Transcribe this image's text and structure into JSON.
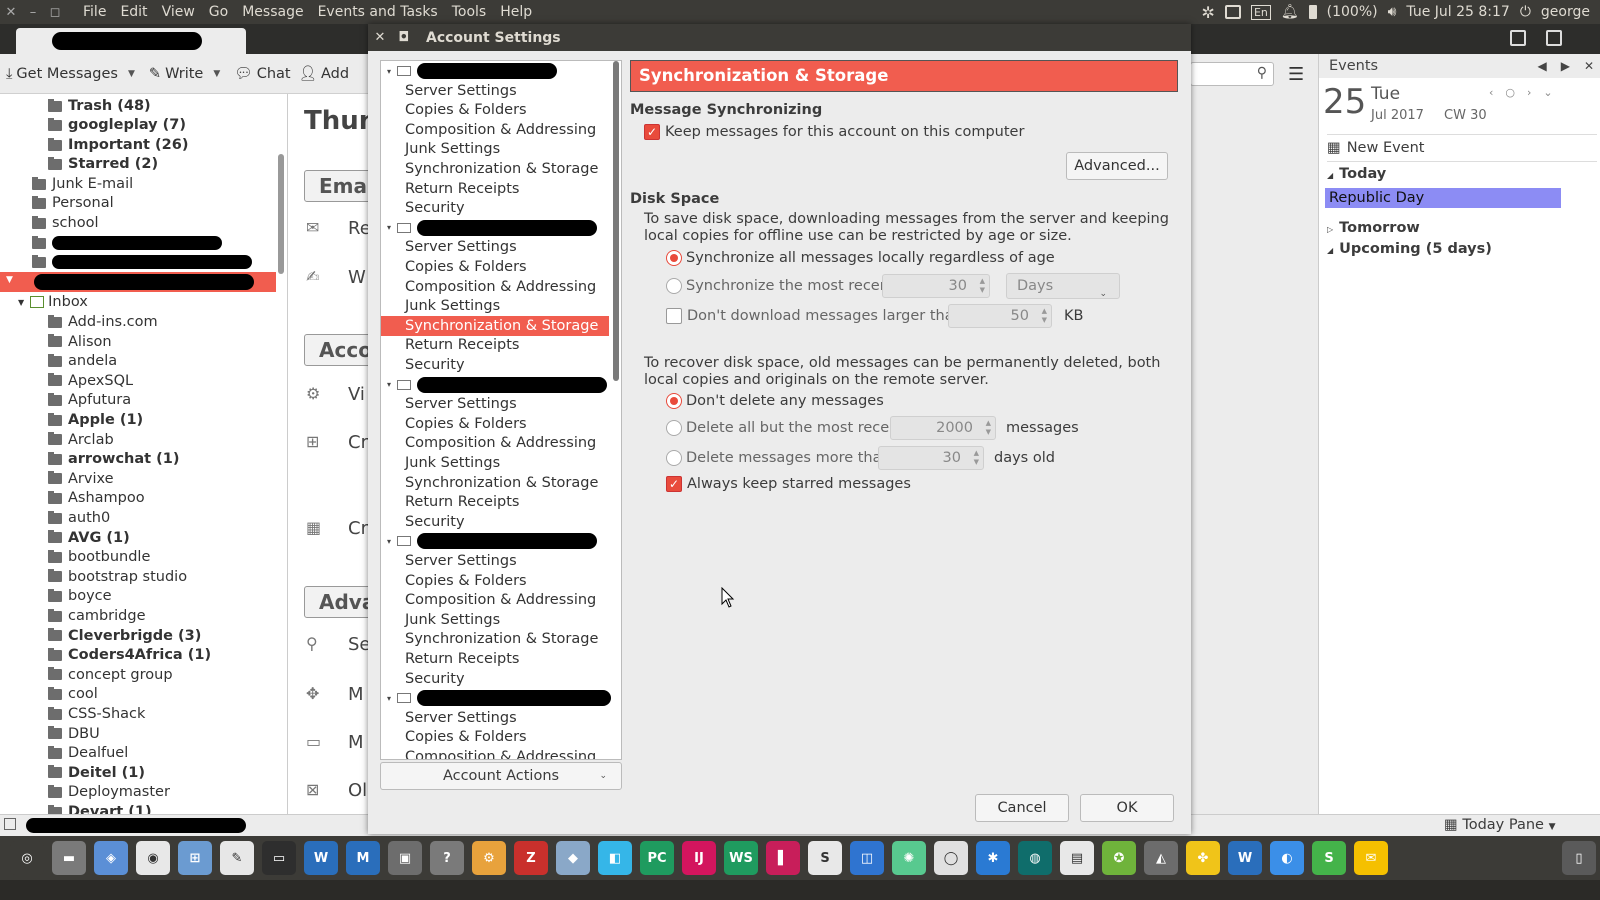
{
  "system_bar": {
    "menu": [
      "File",
      "Edit",
      "View",
      "Go",
      "Message",
      "Events and Tasks",
      "Tools",
      "Help"
    ],
    "battery": "(100%)",
    "datetime": "Tue Jul 25  8:17",
    "user": "george",
    "keyboard": "En"
  },
  "toolbar": {
    "get_messages": "Get Messages",
    "write": "Write",
    "chat": "Chat",
    "address": "Add"
  },
  "folders": {
    "items": [
      {
        "label": "Trash (48)",
        "bold": true
      },
      {
        "label": "googleplay (7)",
        "bold": true
      },
      {
        "label": "Important (26)",
        "bold": true
      },
      {
        "label": "Starred (2)",
        "bold": true
      },
      {
        "label": "Junk E-mail",
        "bold": false
      },
      {
        "label": "Personal",
        "bold": false
      },
      {
        "label": "school",
        "bold": false
      }
    ],
    "inbox": "Inbox",
    "subfolders": [
      {
        "label": "Add-ins.com",
        "bold": false
      },
      {
        "label": "Alison",
        "bold": false
      },
      {
        "label": "andela",
        "bold": false
      },
      {
        "label": "ApexSQL",
        "bold": false
      },
      {
        "label": "Apfutura",
        "bold": false
      },
      {
        "label": "Apple (1)",
        "bold": true
      },
      {
        "label": "Arclab",
        "bold": false
      },
      {
        "label": "arrowchat (1)",
        "bold": true
      },
      {
        "label": "Arvixe",
        "bold": false
      },
      {
        "label": "Ashampoo",
        "bold": false
      },
      {
        "label": "auth0",
        "bold": false
      },
      {
        "label": "AVG (1)",
        "bold": true
      },
      {
        "label": "bootbundle",
        "bold": false
      },
      {
        "label": "bootstrap studio",
        "bold": false
      },
      {
        "label": "boyce",
        "bold": false
      },
      {
        "label": "cambridge",
        "bold": false
      },
      {
        "label": "Cleverbrigde (3)",
        "bold": true
      },
      {
        "label": "Coders4Africa (1)",
        "bold": true
      },
      {
        "label": "concept group",
        "bold": false
      },
      {
        "label": "cool",
        "bold": false
      },
      {
        "label": "CSS-Shack",
        "bold": false
      },
      {
        "label": "DBU",
        "bold": false
      },
      {
        "label": "Dealfuel",
        "bold": false
      },
      {
        "label": "Deitel (1)",
        "bold": true
      },
      {
        "label": "Deploymaster",
        "bold": false
      },
      {
        "label": "Devart (1)",
        "bold": true
      }
    ]
  },
  "content_behind": {
    "title": "Thun",
    "box1": "Ema",
    "row1": "Re",
    "row2": "W",
    "box2": "Acco",
    "row3": "Vi",
    "row4": "Cr",
    "row5": "Cr",
    "box3": "Adva",
    "row6": "Se",
    "row7": "M",
    "row8": "M",
    "row9": "Ol"
  },
  "dialog": {
    "title": "Account Settings",
    "tree_items": [
      "Server Settings",
      "Copies & Folders",
      "Composition & Addressing",
      "Junk Settings",
      "Synchronization & Storage",
      "Return Receipts",
      "Security"
    ],
    "account_actions": "Account Actions",
    "panel_title": "Synchronization & Storage",
    "msg_sync_heading": "Message Synchronizing",
    "keep_messages": "Keep messages for this account on this computer",
    "advanced": "Advanced...",
    "disk_space_heading": "Disk Space",
    "disk_space_desc": "To save disk space, downloading messages from the server and keeping local copies for offline use can be restricted by age or size.",
    "sync_all": "Synchronize all messages locally regardless of age",
    "sync_recent": "Synchronize the most recent",
    "sync_recent_value": "30",
    "sync_recent_unit": "Days",
    "dont_download": "Don't download messages larger than",
    "dont_download_value": "50",
    "dont_download_unit": "KB",
    "recover_desc": "To recover disk space, old messages can be permanently deleted, both local copies and originals on the remote server.",
    "dont_delete": "Don't delete any messages",
    "delete_all_but": "Delete all but the most recent",
    "delete_all_but_value": "2000",
    "delete_all_but_unit": "messages",
    "delete_more_than": "Delete messages more than",
    "delete_more_than_value": "30",
    "delete_more_than_unit": "days old",
    "always_keep_starred": "Always keep starred messages",
    "cancel": "Cancel",
    "ok": "OK"
  },
  "events": {
    "title": "Events",
    "day_num": "25",
    "day_name": "Tue",
    "month_year": "Jul 2017",
    "cw": "CW 30",
    "new_event": "New Event",
    "today": "Today",
    "today_event": "Republic Day",
    "tomorrow": "Tomorrow",
    "upcoming": "Upcoming (5 days)"
  },
  "statusbar": {
    "today_pane": "Today Pane"
  },
  "taskbar_apps": [
    "ubuntu-dash",
    "files",
    "image-viewer",
    "chrome",
    "software-center",
    "editor",
    "terminal",
    "wps-writer",
    "wps-math",
    "vm",
    "help",
    "settings",
    "filezilla",
    "box",
    "atom-blue",
    "pycharm",
    "intellij",
    "webstorm",
    "gitkraken",
    "sublime",
    "windows",
    "atom",
    "disc",
    "vscode",
    "gitkraken-2",
    "document-viewer",
    "android-studio",
    "network",
    "puzzle",
    "writer-2",
    "browser",
    "sublime-2",
    "mail"
  ],
  "colors": {
    "accent": "#f15d4f",
    "title_bar": "#3c3b37",
    "event_highlight": "#8c8cf4"
  }
}
